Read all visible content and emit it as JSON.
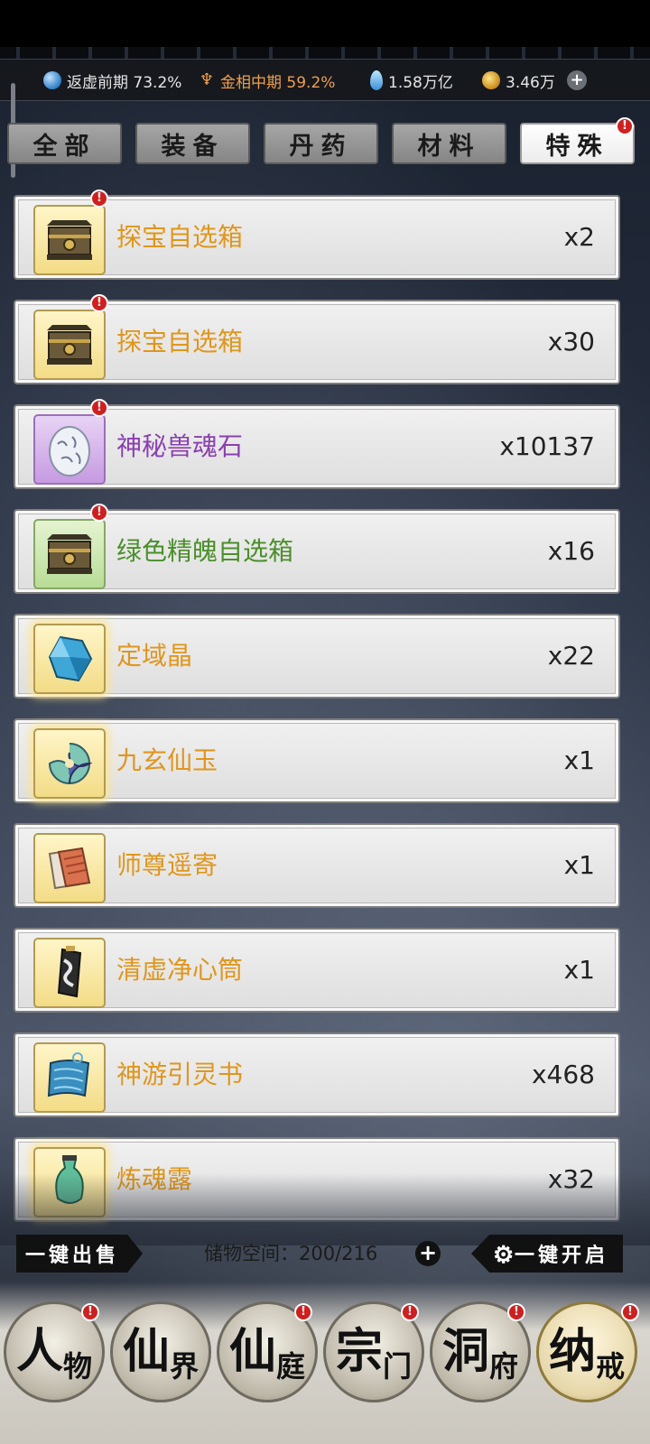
{
  "resources": [
    {
      "icon": "realm-swirl-icon",
      "text": "返虚前期 73.2%"
    },
    {
      "icon": "golden-body-icon",
      "text": "金相中期 59.2%"
    },
    {
      "icon": "spirit-stone-icon",
      "text": "1.58万亿"
    },
    {
      "icon": "gold-coin-icon",
      "text": "3.46万"
    }
  ],
  "tabs": [
    {
      "label": "全部",
      "active": false
    },
    {
      "label": "装备",
      "active": false
    },
    {
      "label": "丹药",
      "active": false
    },
    {
      "label": "材料",
      "active": false
    },
    {
      "label": "特殊",
      "active": true,
      "badge": "!"
    }
  ],
  "items": [
    {
      "name": "探宝自选箱",
      "count": "x2",
      "quality": "yellow",
      "name_color": "orange",
      "icon": "treasure-chest-icon",
      "badge": "!"
    },
    {
      "name": "探宝自选箱",
      "count": "x30",
      "quality": "yellow",
      "name_color": "orange",
      "icon": "treasure-chest-icon",
      "badge": "!"
    },
    {
      "name": "神秘兽魂石",
      "count": "x10137",
      "quality": "purple",
      "name_color": "purple",
      "icon": "beast-soul-stone-icon",
      "badge": "!"
    },
    {
      "name": "绿色精魄自选箱",
      "count": "x16",
      "quality": "green",
      "name_color": "green",
      "icon": "treasure-chest-icon",
      "badge": "!"
    },
    {
      "name": "定域晶",
      "count": "x22",
      "quality": "yellow-glow",
      "name_color": "orange",
      "icon": "blue-crystal-icon"
    },
    {
      "name": "九玄仙玉",
      "count": "x1",
      "quality": "yellow-glow",
      "name_color": "orange",
      "icon": "jade-swirl-icon"
    },
    {
      "name": "师尊遥寄",
      "count": "x1",
      "quality": "yellow",
      "name_color": "orange",
      "icon": "letter-scrolls-icon"
    },
    {
      "name": "清虚净心筒",
      "count": "x1",
      "quality": "yellow",
      "name_color": "orange",
      "icon": "bamboo-tube-icon"
    },
    {
      "name": "神游引灵书",
      "count": "x468",
      "quality": "yellow",
      "name_color": "orange",
      "icon": "blue-scroll-icon"
    },
    {
      "name": "炼魂露",
      "count": "x32",
      "quality": "yellow-glow",
      "name_color": "orange",
      "icon": "potion-vase-icon"
    }
  ],
  "bottom_bar": {
    "sell_label": "一键出售",
    "storage_text": "储物空间：200/216",
    "open_label": "一键开启"
  },
  "nav": [
    {
      "big": "人",
      "small": "物",
      "badge": "!"
    },
    {
      "big": "仙",
      "small": "界",
      "badge": ""
    },
    {
      "big": "仙",
      "small": "庭",
      "badge": "!"
    },
    {
      "big": "宗",
      "small": "门",
      "badge": "!"
    },
    {
      "big": "洞",
      "small": "府",
      "badge": "!"
    },
    {
      "big": "纳",
      "small": "戒",
      "badge": "!",
      "active": true
    }
  ],
  "colors": {
    "orange": "#e0961a",
    "purple": "#8a3fb2",
    "green": "#4b8f2a",
    "badge_red": "#d21e1e"
  }
}
